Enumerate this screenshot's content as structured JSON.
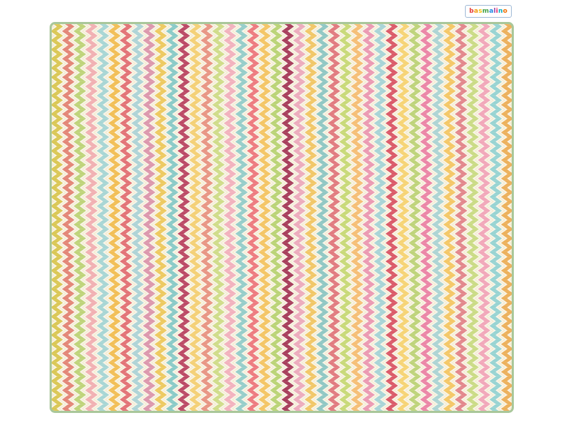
{
  "brand": {
    "name": "basmalino",
    "letter_colors": [
      "#e53935",
      "#f39c12",
      "#f4c20d",
      "#43a047",
      "#1e88e5",
      "#8e44ad",
      "#e91e63",
      "#00acc1",
      "#ef6c00"
    ]
  },
  "rug": {
    "description_icon": "zigzag-rug",
    "background_color": "#f4ecd2",
    "border_color": "#a9c79a",
    "stripe_colors": [
      "#d7c247",
      "#e17b6b",
      "#b8cf6f",
      "#f0a9ad",
      "#9fd1d1",
      "#f1b948",
      "#e0666a",
      "#a7cfd4",
      "#d98ea6",
      "#ebc453",
      "#7fc5c2",
      "#b53858",
      "#f3cc6a",
      "#e68c79",
      "#cbd980",
      "#f1aab8",
      "#8cc9c6",
      "#ec6f74",
      "#f3c058",
      "#b4cf6a",
      "#9f2d4e",
      "#eaa4b7",
      "#f0c15a",
      "#86c2bf",
      "#de6f74",
      "#c3d66d",
      "#f4b96a",
      "#e990ad",
      "#9fd0d4",
      "#d74b5c",
      "#f5cf69",
      "#b8cf6f",
      "#e97ba0",
      "#a5d0d0",
      "#f3c25a",
      "#e07c82",
      "#c6d87b",
      "#f0a0b4",
      "#8ecfcf",
      "#eaa94d"
    ]
  }
}
